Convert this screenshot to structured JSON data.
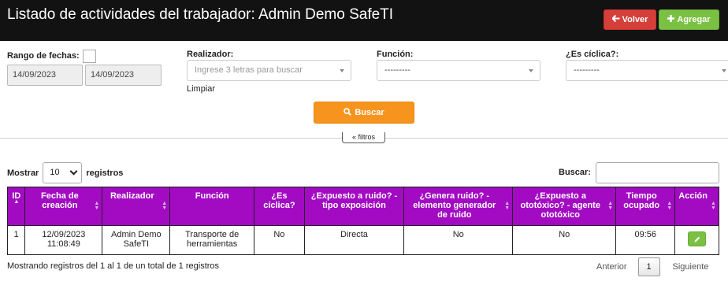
{
  "header": {
    "title": "Listado de actividades del trabajador: Admin Demo SafeTI",
    "back_label": "Volver",
    "add_label": "Agregar"
  },
  "filters": {
    "date_range_label": "Rango de fechas:",
    "date_from": "14/09/2023",
    "date_to": "14/09/2023",
    "realizador_label": "Realizador:",
    "realizador_placeholder": "Ingrese 3 letras para buscar",
    "funcion_label": "Función:",
    "funcion_value": "---------",
    "ciclica_label": "¿Es cíclica?:",
    "ciclica_value": "---------",
    "clear_label": "Limpiar",
    "search_label": "Buscar",
    "toggle_label": "filtros"
  },
  "table_controls": {
    "show_label": "Mostrar",
    "page_length": "10",
    "records_label": "registros",
    "search_label": "Buscar:"
  },
  "table": {
    "columns": [
      "ID",
      "Fecha de creación",
      "Realizador",
      "Función",
      "¿Es cíclica?",
      "¿Expuesto a ruido? - tipo exposición",
      "¿Genera ruido? - elemento generador de ruido",
      "¿Expuesto a ototóxico? - agente ototóxico",
      "Tiempo ocupado",
      "Acción"
    ],
    "rows": [
      {
        "id": "1",
        "fecha": "12/09/2023 11:08:49",
        "realizador": "Admin Demo SafeTI",
        "funcion": "Transporte de herramientas",
        "ciclica": "No",
        "expuesto_ruido": "Directa",
        "genera_ruido": "No",
        "ototoxico": "No",
        "tiempo": "09:56"
      }
    ]
  },
  "footer": {
    "info": "Mostrando registros del 1 al 1 de un total de 1 registros",
    "prev_label": "Anterior",
    "current_page": "1",
    "next_label": "Siguiente"
  },
  "colors": {
    "header_bg": "#121212",
    "back_button": "#d43f3a",
    "add_button": "#7ac143",
    "search_button": "#f7941d",
    "table_header": "#a20bc2"
  },
  "icons": {
    "back": "arrow-left-icon",
    "add": "plus-icon",
    "search": "search-icon",
    "toggle": "double-chevron-up-icon",
    "edit": "pencil-icon"
  }
}
